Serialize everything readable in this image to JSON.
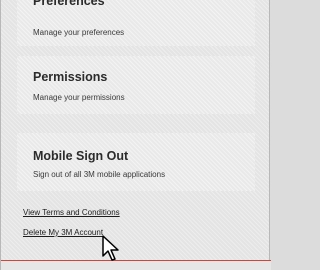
{
  "sections": {
    "preferences": {
      "title": "Preferences",
      "description": "Manage your preferences"
    },
    "permissions": {
      "title": "Permissions",
      "description": "Manage your permissions"
    },
    "mobile_sign_out": {
      "title": "Mobile Sign Out",
      "description": "Sign out of all 3M mobile applications"
    }
  },
  "links": {
    "terms": "View Terms and Conditions",
    "delete_account": "Delete My 3M Account"
  },
  "colors": {
    "accent_line": "#d2443a"
  },
  "icons": {
    "cursor": "hand-pointer-cursor"
  }
}
